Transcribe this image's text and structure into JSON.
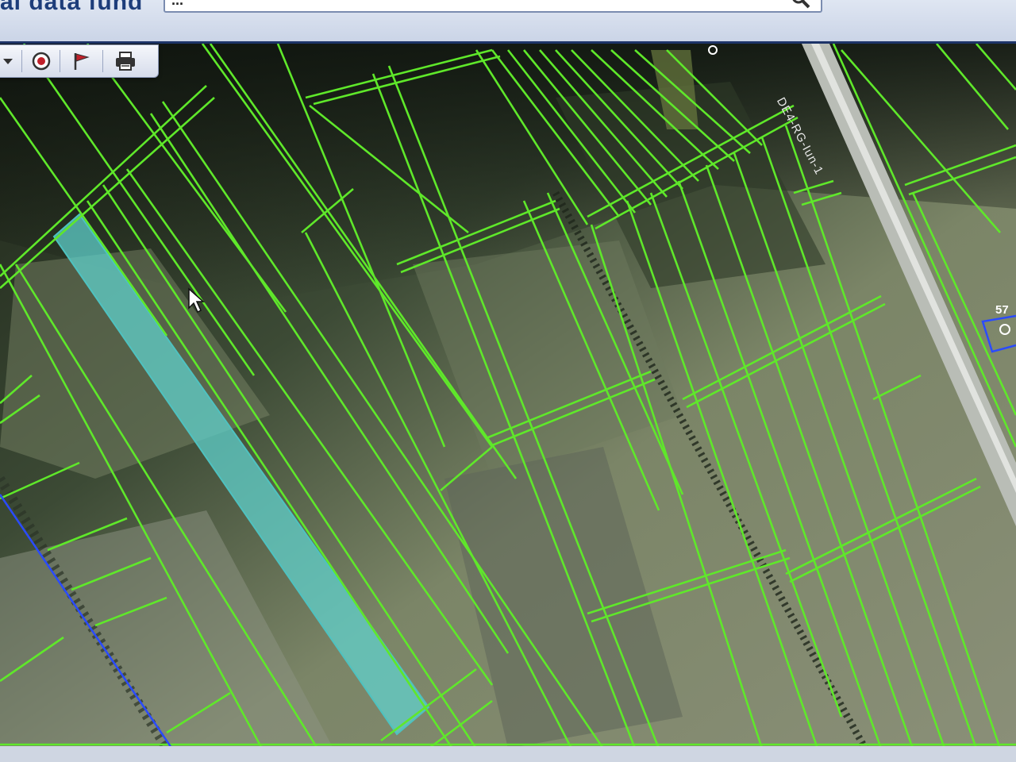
{
  "header": {
    "title": "al data fund",
    "search_value": "...",
    "search_icon": "search-icon"
  },
  "toolbar": {
    "items": [
      {
        "icon": "dropdown-arrow-icon"
      },
      {
        "icon": "target-icon"
      },
      {
        "icon": "flag-icon"
      },
      {
        "icon": "print-icon"
      }
    ]
  },
  "map": {
    "road_label": "DE4-RG-Iun-1",
    "parcel_number": "57",
    "colors": {
      "parcel_border": "#5fe82a",
      "selected_parcel": "#5fd4d0",
      "boundary_blue": "#2a4bff"
    }
  }
}
